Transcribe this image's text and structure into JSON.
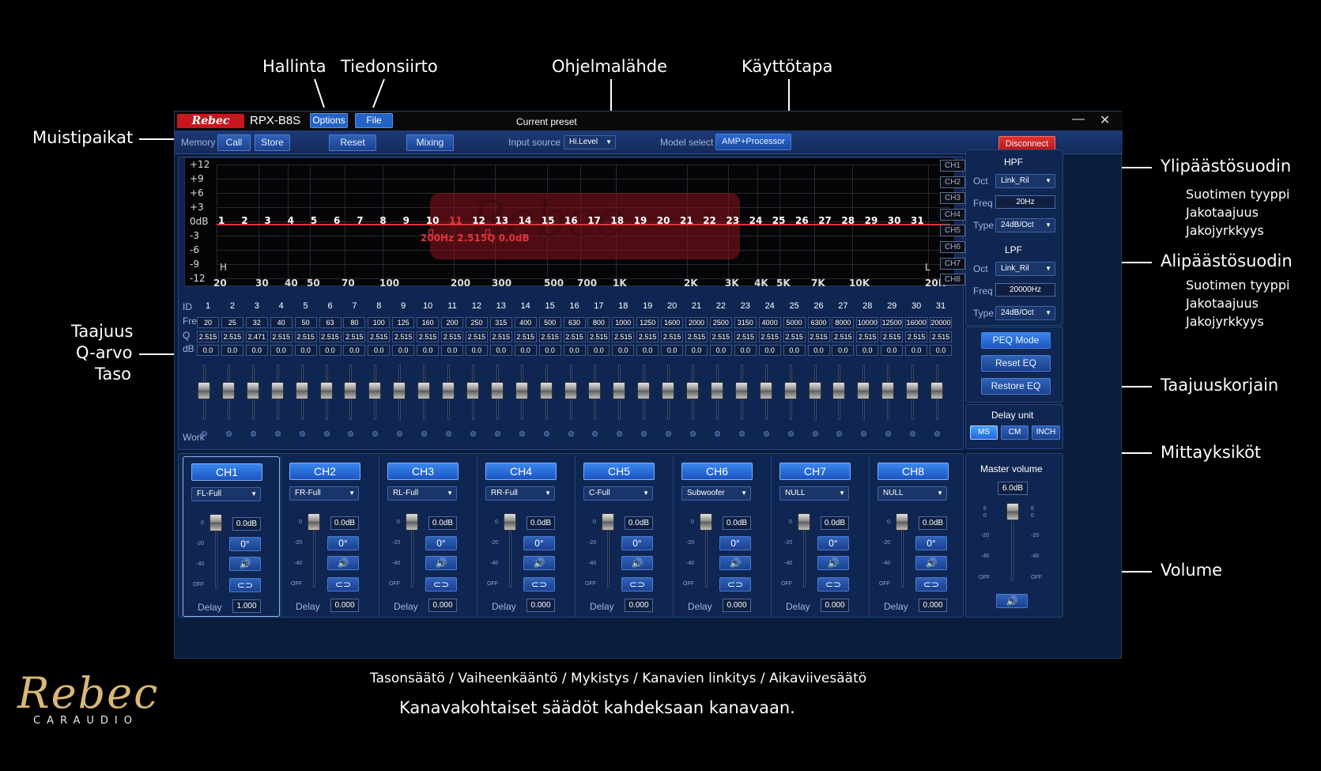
{
  "annotations": {
    "hallinta": "Hallinta",
    "tiedonsiirto": "Tiedonsiirto",
    "ohjelmalahde": "Ohjelmalähde",
    "kayttotapa": "Käyttötapa",
    "muistipaikat": "Muistipaikat",
    "ylipaastosuodin": "Ylipäästösuodin",
    "ylipaasto_lines": [
      "Suotimen tyyppi",
      "Jakotaajuus",
      "Jakojyrkkyys"
    ],
    "alipaastosuodin": "Alipäästösuodin",
    "alipaasto_lines": [
      "Suotimen tyyppi",
      "Jakotaajuus",
      "Jakojyrkkyys"
    ],
    "taajuus": "Taajuus",
    "q_arvo": "Q-arvo",
    "taso": "Taso",
    "taajuuskorjain": "Taajuuskorjain",
    "mittayksikot": "Mittayksiköt",
    "volume": "Volume",
    "footer_line1": "Tasonsäätö / Vaiheenkääntö / Mykistys / Kanavien linkitys / Aikaviivesäätö",
    "footer_line2": "Kanavakohtaiset säädöt kahdeksaan kanavaan."
  },
  "brand": {
    "logo_text": "Rebec",
    "logo_sub": "CARAUDIO",
    "titlebar_logo": "Rebec",
    "model": "RPX-B8S"
  },
  "titlebar": {
    "options": "Options",
    "file": "File",
    "current_preset": "Current preset",
    "minimize": "—",
    "close": "✕"
  },
  "toolbar": {
    "memory": "Memory",
    "call": "Call",
    "store": "Store",
    "reset": "Reset",
    "mixing": "Mixing",
    "input_source_label": "Input source",
    "input_source_value": "Hi.Level",
    "model_select_label": "Model select",
    "model_select_value": "AMP+Processor",
    "disconnect": "Disconnect"
  },
  "graph": {
    "y_labels": [
      "+12",
      "+9",
      "+6",
      "+3",
      "0dB",
      "-3",
      "-6",
      "-9",
      "-12"
    ],
    "x_labels": [
      "20",
      "30",
      "40",
      "50",
      "70",
      "100",
      "200",
      "300",
      "500",
      "700",
      "1K",
      "2K",
      "3K",
      "4K",
      "5K",
      "7K",
      "10K",
      "20K"
    ],
    "h_label": "H",
    "l_label": "L",
    "watermark": "Rebec",
    "marker_text": "200Hz 2.515Q 0.0dB",
    "channels": [
      "CH1",
      "CH2",
      "CH3",
      "CH4",
      "CH5",
      "CH6",
      "CH7",
      "CH8"
    ],
    "highlight_band": "11"
  },
  "eq": {
    "id_label": "ID",
    "freq_label": "Freq",
    "q_label": "Q",
    "db_label": "dB",
    "work_label": "Work",
    "ids": [
      "1",
      "2",
      "3",
      "4",
      "5",
      "6",
      "7",
      "8",
      "9",
      "10",
      "11",
      "12",
      "13",
      "14",
      "15",
      "16",
      "17",
      "18",
      "19",
      "20",
      "21",
      "22",
      "23",
      "24",
      "25",
      "26",
      "27",
      "28",
      "29",
      "30",
      "31"
    ],
    "freqs": [
      "20",
      "25",
      "32",
      "40",
      "50",
      "63",
      "80",
      "100",
      "125",
      "160",
      "200",
      "250",
      "315",
      "400",
      "500",
      "630",
      "800",
      "1000",
      "1250",
      "1600",
      "2000",
      "2500",
      "3150",
      "4000",
      "5000",
      "6300",
      "8000",
      "10000",
      "12500",
      "16000",
      "20000"
    ],
    "q": [
      "2.515",
      "2.515",
      "2.471",
      "2.515",
      "2.515",
      "2.515",
      "2.515",
      "2.515",
      "2.515",
      "2.515",
      "2.515",
      "2.515",
      "2.515",
      "2.515",
      "2.515",
      "2.515",
      "2.515",
      "2.515",
      "2.515",
      "2.515",
      "2.515",
      "2.515",
      "2.515",
      "2.515",
      "2.515",
      "2.515",
      "2.515",
      "2.515",
      "2.515",
      "2.515",
      "2.515"
    ],
    "db": [
      "0.0",
      "0.0",
      "0.0",
      "0.0",
      "0.0",
      "0.0",
      "0.0",
      "0.0",
      "0.0",
      "0.0",
      "0.0",
      "0.0",
      "0.0",
      "0.0",
      "0.0",
      "0.0",
      "0.0",
      "0.0",
      "0.0",
      "0.0",
      "0.0",
      "0.0",
      "0.0",
      "0.0",
      "0.0",
      "0.0",
      "0.0",
      "0.0",
      "0.0",
      "0.0",
      "0.0"
    ]
  },
  "filters": {
    "hpf_title": "HPF",
    "lpf_title": "LPF",
    "oct_label": "Oct",
    "freq_label": "Freq",
    "type_label": "Type",
    "hpf_oct": "Link_Ril",
    "hpf_freq": "20Hz",
    "hpf_type": "24dB/Oct",
    "lpf_oct": "Link_Ril",
    "lpf_freq": "20000Hz",
    "lpf_type": "24dB/Oct",
    "peq_mode": "PEQ Mode",
    "reset_eq": "Reset EQ",
    "restore_eq": "Restore EQ",
    "delay_unit": "Delay unit",
    "ms": "MS",
    "cm": "CM",
    "inch": "INCH"
  },
  "channels": [
    {
      "name": "CH1",
      "source": "FL-Full",
      "level": "0.0dB",
      "phase": "0°",
      "delay": "1.000"
    },
    {
      "name": "CH2",
      "source": "FR-Full",
      "level": "0.0dB",
      "phase": "0°",
      "delay": "0.000"
    },
    {
      "name": "CH3",
      "source": "RL-Full",
      "level": "0.0dB",
      "phase": "0°",
      "delay": "0.000"
    },
    {
      "name": "CH4",
      "source": "RR-Full",
      "level": "0.0dB",
      "phase": "0°",
      "delay": "0.000"
    },
    {
      "name": "CH5",
      "source": "C-Full",
      "level": "0.0dB",
      "phase": "0°",
      "delay": "0.000"
    },
    {
      "name": "CH6",
      "source": "Subwoofer",
      "level": "0.0dB",
      "phase": "0°",
      "delay": "0.000"
    },
    {
      "name": "CH7",
      "source": "NULL",
      "level": "0.0dB",
      "phase": "0°",
      "delay": "0.000"
    },
    {
      "name": "CH8",
      "source": "NULL",
      "level": "0.0dB",
      "phase": "0°",
      "delay": "0.000"
    }
  ],
  "channel_common": {
    "delay_label": "Delay",
    "scale": [
      "0",
      "-20",
      "-40",
      "OFF"
    ]
  },
  "master": {
    "title": "Master volume",
    "value": "6.0dB",
    "scale": [
      "6",
      "0",
      "-20",
      "-40",
      "OFF"
    ]
  }
}
